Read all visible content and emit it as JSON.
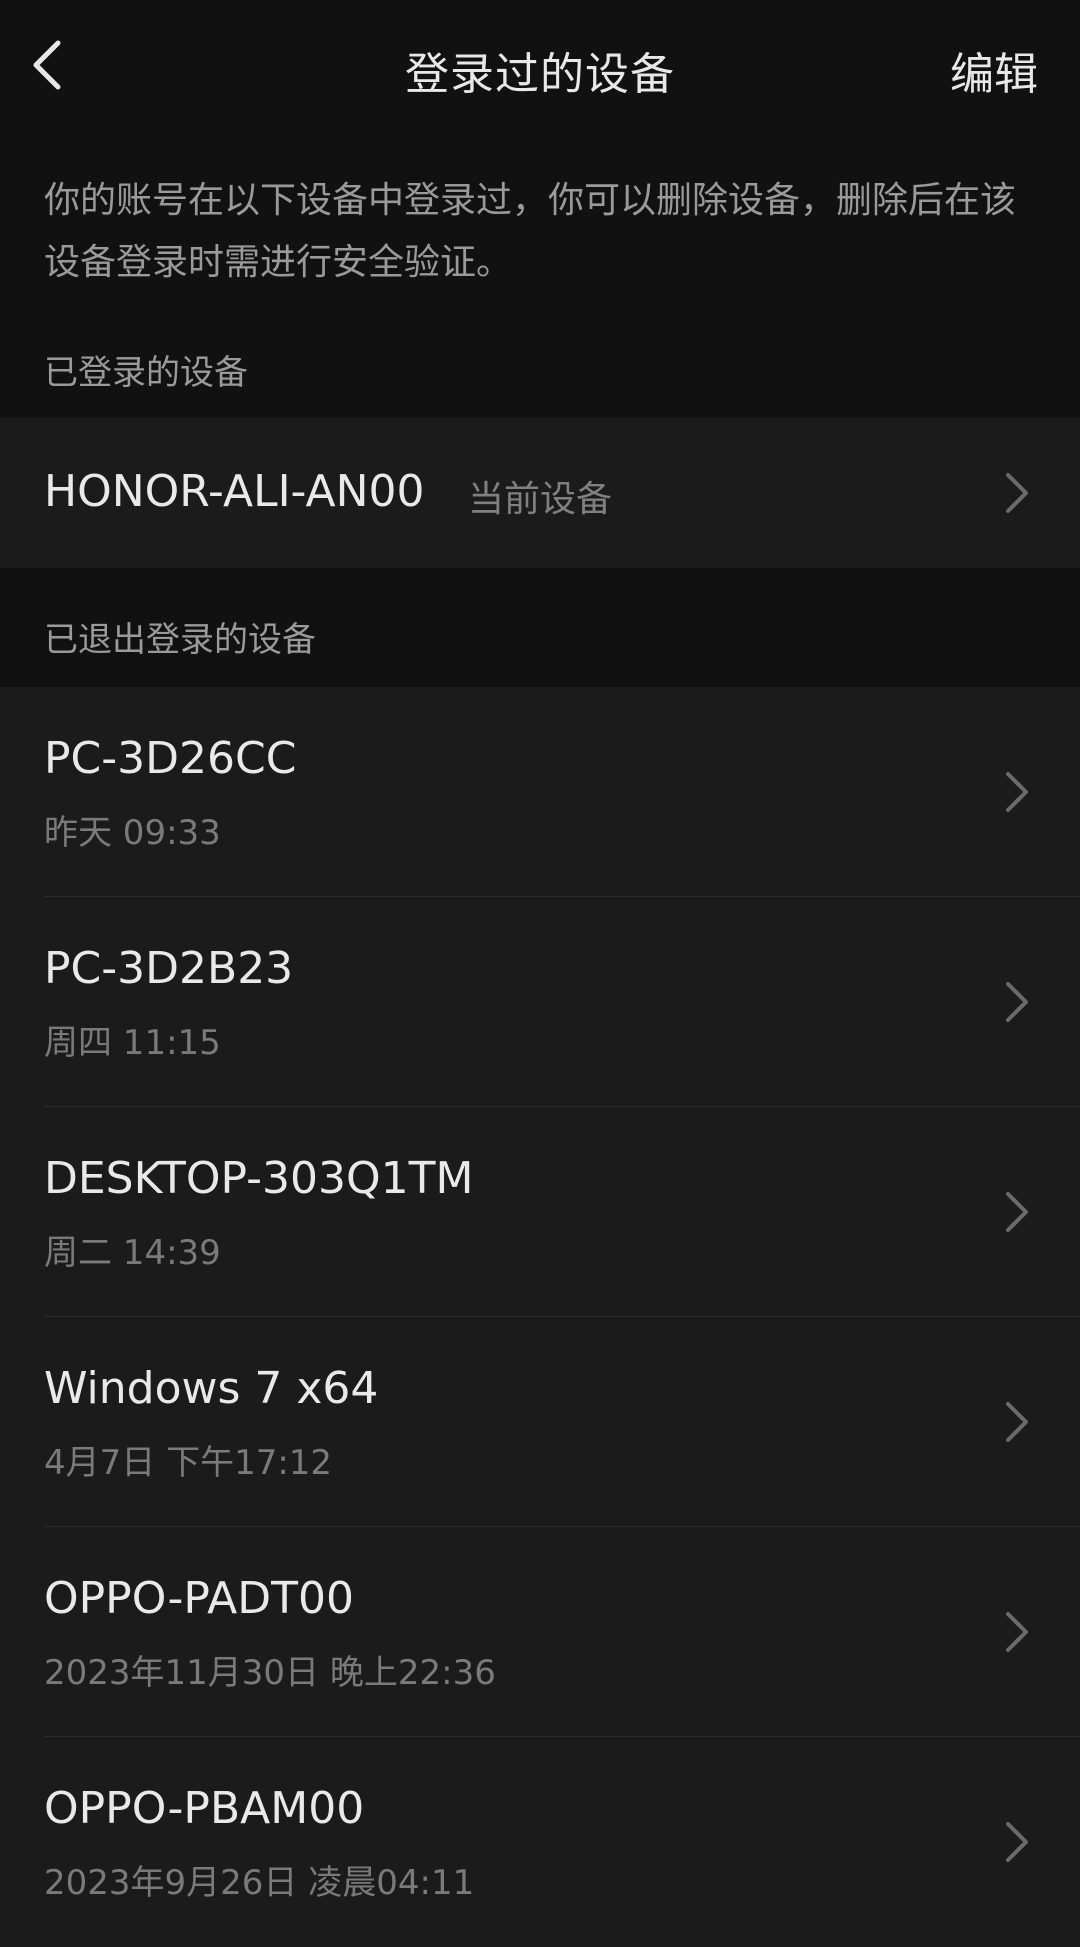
{
  "header": {
    "title": "登录过的设备",
    "edit_label": "编辑",
    "back_icon": "chevron-left-icon"
  },
  "description": "你的账号在以下设备中登录过，你可以删除设备，删除后在该设备登录时需进行安全验证。",
  "logged_in_section": {
    "label": "已登录的设备",
    "device": {
      "name": "HONOR-ALI-AN00",
      "badge": "当前设备"
    }
  },
  "logged_out_section": {
    "label": "已退出登录的设备",
    "devices": [
      {
        "name": "PC-3D26CC",
        "time": "昨天 09:33"
      },
      {
        "name": "PC-3D2B23",
        "time": "周四 11:15"
      },
      {
        "name": "DESKTOP-303Q1TM",
        "time": "周二 14:39"
      },
      {
        "name": "Windows 7 x64",
        "time": "4月7日 下午17:12"
      },
      {
        "name": "OPPO-PADT00",
        "time": "2023年11月30日 晚上22:36"
      },
      {
        "name": "OPPO-PBAM00",
        "time": "2023年9月26日 凌晨04:11"
      }
    ]
  },
  "colors": {
    "background": "#111111",
    "card": "#1b1b1b",
    "primary_text": "#e9e9e9",
    "secondary_text": "#7a7a7a"
  }
}
